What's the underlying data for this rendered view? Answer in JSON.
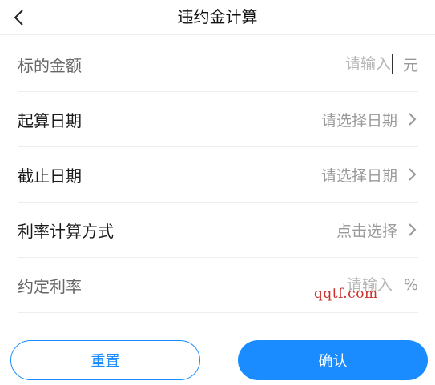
{
  "header": {
    "title": "违约金计算"
  },
  "fields": [
    {
      "label": "标的金额",
      "placeholder": "请输入",
      "unit": "元"
    },
    {
      "label": "起算日期",
      "value": "请选择日期"
    },
    {
      "label": "截止日期",
      "value": "请选择日期"
    },
    {
      "label": "利率计算方式",
      "value": "点击选择"
    },
    {
      "label": "约定利率",
      "placeholder": "请输入",
      "unit": "%"
    }
  ],
  "watermark": "qqtf.com",
  "buttons": {
    "reset": "重置",
    "confirm": "确认"
  },
  "colors": {
    "accent": "#1a8cff",
    "placeholder": "#b5b5b5"
  },
  "icons": {
    "back": "chevron-left-icon",
    "disclosure": "chevron-right-icon"
  }
}
